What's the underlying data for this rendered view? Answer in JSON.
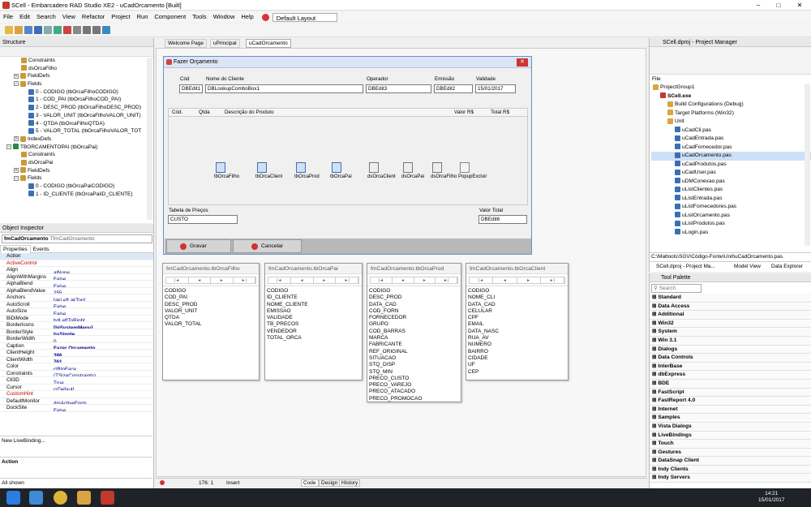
{
  "window": {
    "title": "SCell - Embarcadero RAD Studio XE2 - uCadOrcamento [Built]",
    "min": "–",
    "max": "□",
    "close": "✕"
  },
  "menu": [
    "File",
    "Edit",
    "Search",
    "View",
    "Refactor",
    "Project",
    "Run",
    "Component",
    "Tools",
    "Window",
    "Help"
  ],
  "layout_combo": "Default Layout",
  "structure": {
    "title": "Structure",
    "items": [
      {
        "t": "Constraints",
        "lvl": 2
      },
      {
        "t": "dsOrcaFilho",
        "lvl": 2
      },
      {
        "t": "FieldDefs",
        "lvl": 1,
        "exp": "+"
      },
      {
        "t": "Fields",
        "lvl": 1,
        "exp": "−"
      },
      {
        "t": "0 - CODIGO (tbOrcaFilhoCODIGO)",
        "lvl": 3
      },
      {
        "t": "1 - COD_PAI (tbOrcaFilhoCOD_PAI)",
        "lvl": 3
      },
      {
        "t": "2 - DESC_PROD (tbOrcaFilhoDESC_PROD)",
        "lvl": 3
      },
      {
        "t": "3 - VALOR_UNIT (tbOrcaFilhoVALOR_UNIT)",
        "lvl": 3
      },
      {
        "t": "4 - QTDA (tbOrcaFilhoQTDA)",
        "lvl": 3
      },
      {
        "t": "5 - VALOR_TOTAL (tbOrcaFilhoVALOR_TOT",
        "lvl": 3
      },
      {
        "t": "IndexDefs",
        "lvl": 1,
        "exp": "+"
      },
      {
        "t": "TBORCAMENTOPAI (tbOrcaPai)",
        "lvl": 0,
        "exp": "−"
      },
      {
        "t": "Constraints",
        "lvl": 2
      },
      {
        "t": "dsOrcaPai",
        "lvl": 2
      },
      {
        "t": "FieldDefs",
        "lvl": 1,
        "exp": "+"
      },
      {
        "t": "Fields",
        "lvl": 1,
        "exp": "−"
      },
      {
        "t": "0 - CODIGO (tbOrcaPaiCODIGO)",
        "lvl": 3
      },
      {
        "t": "1 - ID_CLIENTE (tbOrcaPaiID_CLIENTE)",
        "lvl": 3
      }
    ]
  },
  "inspector": {
    "title": "Object Inspector",
    "object": "fmCadOrcamento",
    "class": "TfmCadOrcamento",
    "tabs": [
      "Properties",
      "Events"
    ],
    "rows": [
      [
        "Action",
        ""
      ],
      [
        "ActiveControl",
        ""
      ],
      [
        "Align",
        "alNone"
      ],
      [
        "AlignWithMargins",
        "False"
      ],
      [
        "AlphaBlend",
        "False"
      ],
      [
        "AlphaBlendValue",
        "255"
      ],
      [
        "Anchors",
        "[akLeft,akTop]"
      ],
      [
        "AutoScroll",
        "False"
      ],
      [
        "AutoSize",
        "False"
      ],
      [
        "BiDiMode",
        "bdLeftToRight"
      ],
      [
        "BorderIcons",
        "[biSystemMenu]"
      ],
      [
        "BorderStyle",
        "bsSingle"
      ],
      [
        "BorderWidth",
        "0"
      ],
      [
        "Caption",
        "Fazer Orçamento"
      ],
      [
        "ClientHeight",
        "386"
      ],
      [
        "ClientWidth",
        "761"
      ],
      [
        "Color",
        "clBtnFace"
      ],
      [
        "Constraints",
        "(TSizeConstraints)"
      ],
      [
        "Ctl3D",
        "True"
      ],
      [
        "Cursor",
        "crDefault"
      ],
      [
        "CustomHint",
        ""
      ],
      [
        "DefaultMonitor",
        "dmActiveForm"
      ],
      [
        "DockSite",
        "False"
      ]
    ],
    "livebind": "New LiveBinding...",
    "action": "Action",
    "status": "All shown"
  },
  "tabs": [
    "Welcome Page",
    "uPrincipal",
    "uCadOrcamento"
  ],
  "form": {
    "caption": "Fazer Orçamento",
    "labels": {
      "cod": "Cód",
      "cliente": "Nome do Cliente",
      "operador": "Operador",
      "emissao": "Emissão",
      "validade": "Validade"
    },
    "edits": {
      "cod": "DBEdit1",
      "cliente": "DBLookupComboBox1",
      "operador": "DBEdit3",
      "emissao": "DBEdit2",
      "validade": "15/01/2017"
    },
    "grid": [
      "Cód.",
      "Qtda",
      "Descrição do Produto",
      "Valor R$",
      "Total R$"
    ],
    "components": [
      "tbOrcaFilho",
      "tbOrcaClient",
      "tbOrcaProd",
      "tbOrcaPai",
      "dsOrcaClient",
      "dsOrcaPai",
      "dsOrcaFilho",
      "PopupExcluir"
    ],
    "tabela_label": "Tabela de Preços",
    "tabela_value": "CUSTO",
    "valor_total_label": "Valor Total",
    "valor_total_value": "DBEdit6",
    "gravar": "Gravar",
    "cancelar": "Cancelar"
  },
  "datasets": [
    {
      "title": "fmCadOrcamento.tbOrcaFilho",
      "fields": [
        "CODIGO",
        "COD_PAI",
        "DESC_PROD",
        "VALOR_UNIT",
        "QTDA",
        "VALOR_TOTAL"
      ]
    },
    {
      "title": "fmCadOrcamento.tbOrcaPai",
      "fields": [
        "CODIGO",
        "ID_CLIENTE",
        "NOME_CLIENTE",
        "EMISSAO",
        "VALIDADE",
        "TB_PRECOS",
        "VENDEDOR",
        "TOTAL_ORCA"
      ]
    },
    {
      "title": "fmCadOrcamento.tbOrcaProd",
      "fields": [
        "CODIGO",
        "DESC_PROD",
        "DATA_CAD",
        "COD_FORN",
        "FORNECEDOR",
        "GRUPO",
        "COD_BARRAS",
        "MARCA",
        "FABRICANTE",
        "REF_ORIGINAL",
        "SITUACAO",
        "STQ_DISP",
        "STQ_MIN",
        "PRECO_CUSTO",
        "PRECO_VAREJO",
        "PRECO_ATACADO",
        "PRECO_PROMOCAO"
      ]
    },
    {
      "title": "fmCadOrcamento.tbOrcaClient",
      "fields": [
        "CODIGO",
        "NOME_CLI",
        "DATA_CAD",
        "CELULAR",
        "CPF",
        "EMAIL",
        "DATA_NASC",
        "RUA_AV",
        "NUMERO",
        "BAIRRO",
        "CIDADE",
        "UF",
        "CEP"
      ]
    }
  ],
  "nav_glyphs": [
    "|◄",
    "◄",
    "►",
    "►|"
  ],
  "editor_status": {
    "pos": "176:  1",
    "mode": "Insert",
    "tabs": [
      "Code",
      "Design",
      "History"
    ]
  },
  "project": {
    "title": "SCell.dproj - Project Manager",
    "file": "File",
    "items": [
      {
        "t": "ProjectGroup1",
        "lvl": 0
      },
      {
        "t": "SCell.exe",
        "lvl": 1,
        "b": true
      },
      {
        "t": "Build Configurations (Debug)",
        "lvl": 2
      },
      {
        "t": "Target Platforms (Win32)",
        "lvl": 2
      },
      {
        "t": "Unit",
        "lvl": 2
      },
      {
        "t": "uCadCli.pas",
        "lvl": 3
      },
      {
        "t": "uCadEntrada.pas",
        "lvl": 3
      },
      {
        "t": "uCadFornecedor.pas",
        "lvl": 3
      },
      {
        "t": "uCadOrcamento.pas",
        "lvl": 3,
        "sel": true
      },
      {
        "t": "uCadProdutos.pas",
        "lvl": 3
      },
      {
        "t": "uCadUser.pas",
        "lvl": 3
      },
      {
        "t": "uDMConexao.pas",
        "lvl": 3
      },
      {
        "t": "uListClientes.pas",
        "lvl": 3
      },
      {
        "t": "uListEntrada.pas",
        "lvl": 3
      },
      {
        "t": "uListFornecedores.pas",
        "lvl": 3
      },
      {
        "t": "uListOrcamento.pas",
        "lvl": 3
      },
      {
        "t": "uListProdutos.pas",
        "lvl": 3
      },
      {
        "t": "uLogin.pas",
        "lvl": 3
      }
    ],
    "path": "C:\\Mattools\\SGV\\Código-Fonte\\Unit\\uCadOrcamento.pas",
    "tabs": [
      "SCell.dproj - Project Ma...",
      "Model View",
      "Data Explorer"
    ]
  },
  "palette": {
    "title": "Tool Palette",
    "search": "Search",
    "cats": [
      "Standard",
      "Data Access",
      "Additional",
      "Win32",
      "System",
      "Win 3.1",
      "Dialogs",
      "Data Controls",
      "InterBase",
      "dbExpress",
      "BDE",
      "FastScript",
      "FastReport 4.0",
      "Internet",
      "Samples",
      "Vista Dialogs",
      "LiveBindings",
      "Touch",
      "Gestures",
      "DataSnap Client",
      "Indy Clients",
      "Indy Servers"
    ]
  },
  "clock": {
    "time": "14:21",
    "date": "15/01/2017"
  }
}
